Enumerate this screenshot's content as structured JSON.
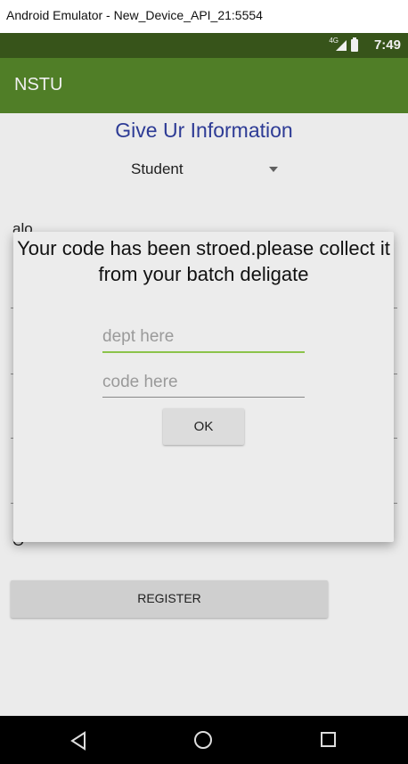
{
  "window": {
    "title": "Android Emulator - New_Device_API_21:5554"
  },
  "status_bar": {
    "network": "4G",
    "time": "7:49"
  },
  "app_bar": {
    "title": "NSTU"
  },
  "form": {
    "heading": "Give Ur Information",
    "role_spinner_value": "Student",
    "partial_texts": [
      "alo",
      "O-"
    ],
    "register_label": "REGISTER"
  },
  "dialog": {
    "message": "Your code has been stroed.please collect it from your batch deligate",
    "dept_placeholder": "dept here",
    "code_placeholder": "code here",
    "ok_label": "OK"
  },
  "navigation": {
    "icons": [
      "back-icon",
      "home-icon",
      "recents-icon"
    ]
  },
  "colors": {
    "app_bar": "#55862a",
    "status_bar": "#3b5a1c",
    "heading": "#303f9f",
    "input_focus": "#8bc34a"
  }
}
